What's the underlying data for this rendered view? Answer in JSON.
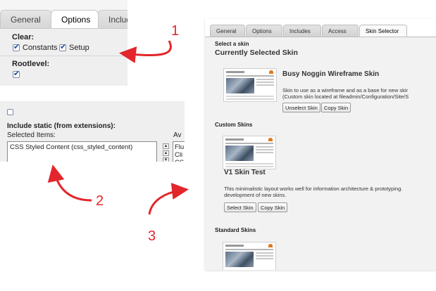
{
  "panel1": {
    "tabs": [
      "General",
      "Options",
      "Include"
    ],
    "clear_label": "Clear:",
    "constants_label": "Constants",
    "setup_label": "Setup",
    "rootlevel_label": "Rootlevel:"
  },
  "panel2": {
    "title": "Include static (from extensions):",
    "selected_label": "Selected Items:",
    "available_label": "Av",
    "selected_items": [
      "CSS Styled Content (css_styled_content)"
    ],
    "available_items": [
      "Flu",
      "Cli",
      "CS"
    ]
  },
  "panel3": {
    "tabs": [
      "General",
      "Options",
      "Includes",
      "Access",
      "Skin Selector"
    ],
    "select_label": "Select a skin",
    "current_heading": "Currently Selected Skin",
    "current_skin": {
      "name": "Busy Noggin Wireframe Skin",
      "desc_line1": "Skin to use as a wireframe and as a base for new skir",
      "desc_line2": "(Custom skin located at fileadmin/Configuration/Site/S",
      "unselect_btn": "Unselect Skin",
      "copy_btn": "Copy Skin"
    },
    "custom_heading": "Custom Skins",
    "custom_skin": {
      "name": "V1 Skin Test",
      "desc_line1": "This minimalistic layout works well for information architecture & prototyping.",
      "desc_line2": "development of new skins.",
      "select_btn": "Select Skin",
      "copy_btn": "Copy Skin"
    },
    "standard_heading": "Standard Skins"
  },
  "callouts": [
    "1",
    "2",
    "3"
  ],
  "colors": {
    "arrow": "#e3262b",
    "checkbox": "#1e4f9e"
  }
}
